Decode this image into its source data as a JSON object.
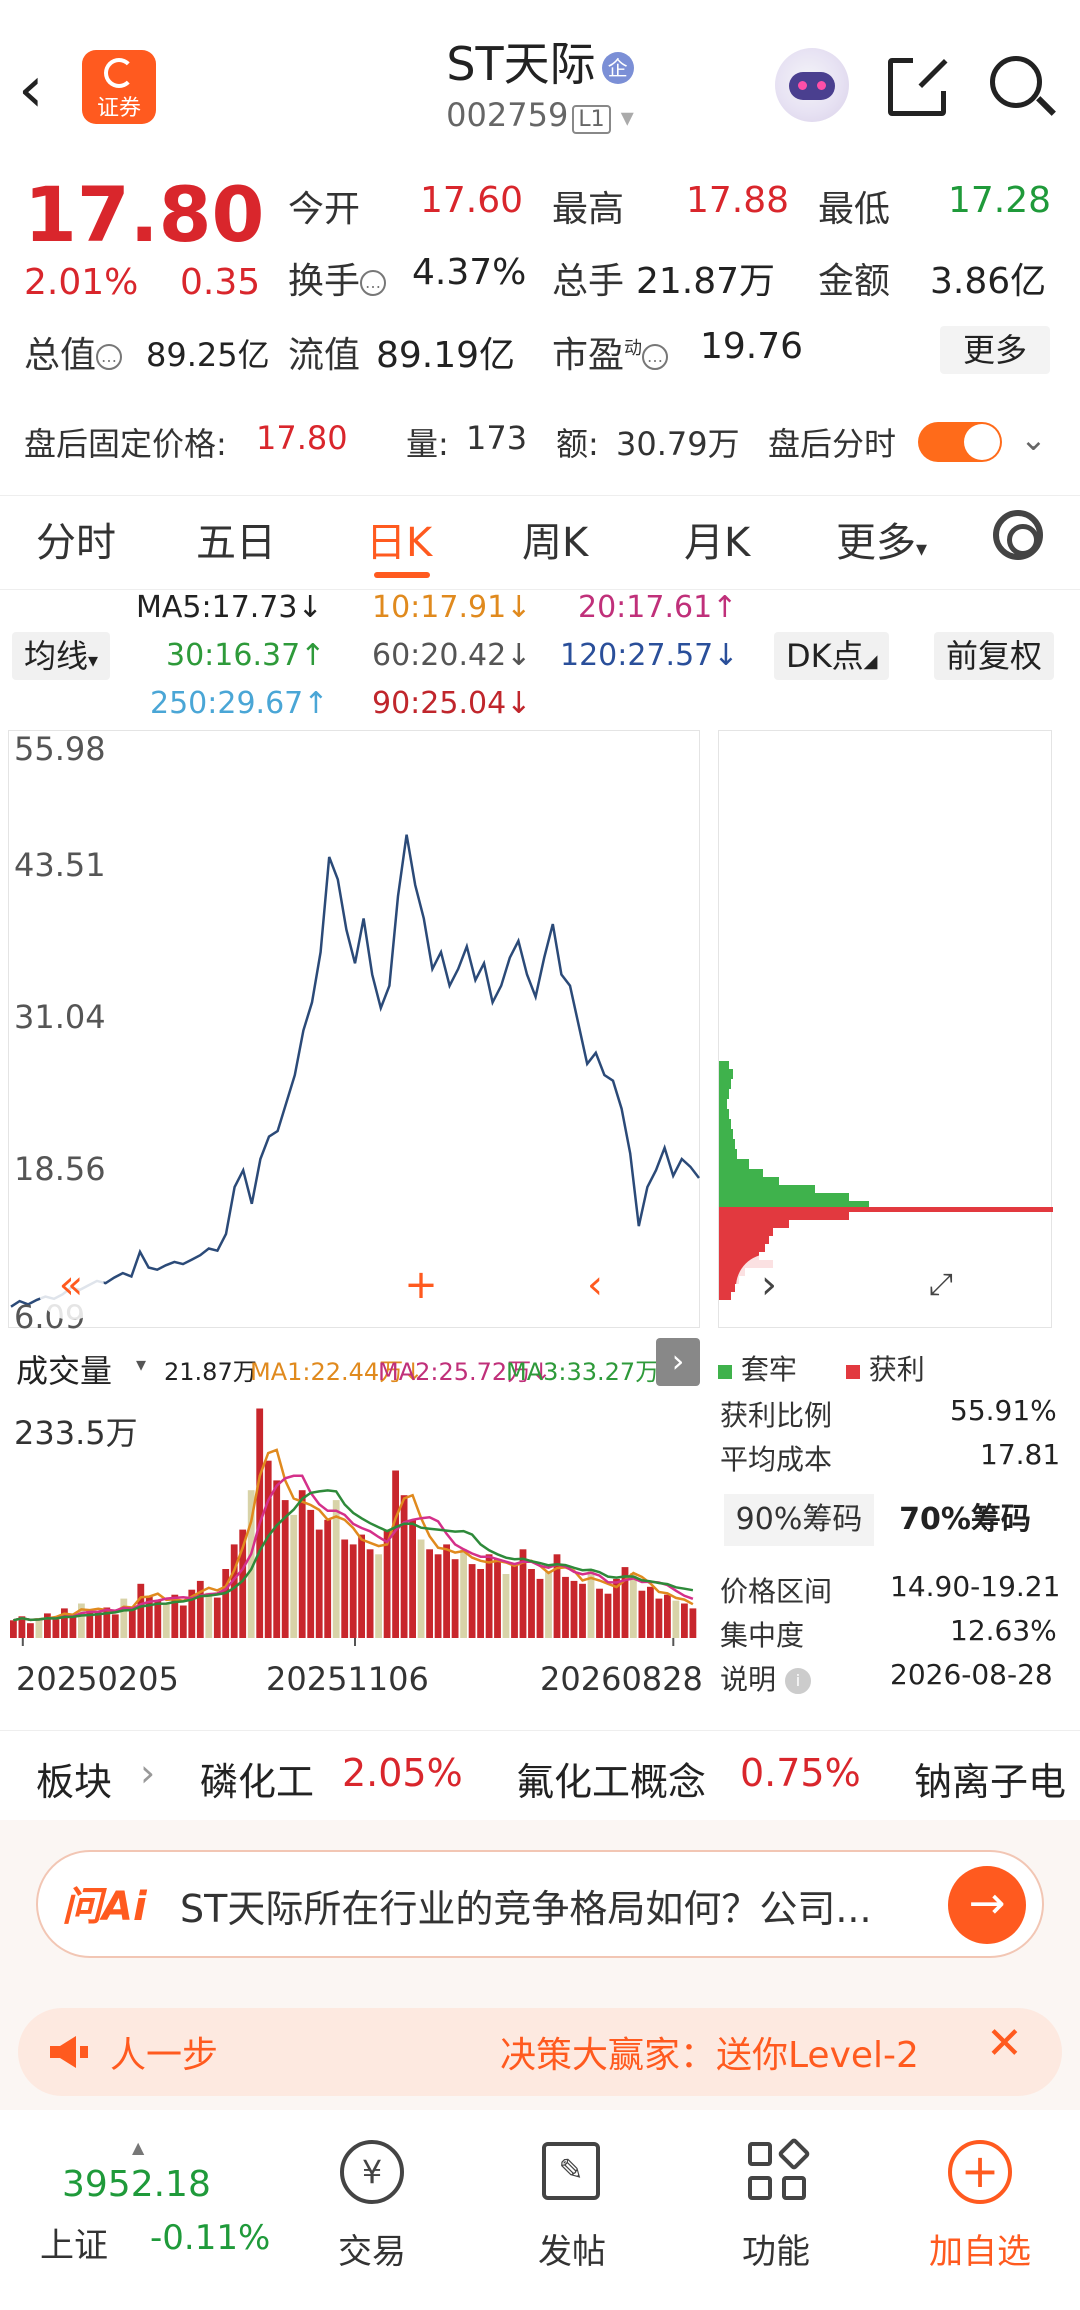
{
  "header": {
    "back_icon": "back-arrow-icon",
    "brand_label": "证券",
    "title": "ST天际",
    "badge": "企",
    "code": "002759",
    "level": "L1"
  },
  "quote": {
    "price": "17.80",
    "change_pct": "2.01%",
    "change_abs": "0.35",
    "fields": [
      {
        "label": "今开",
        "value": "17.60",
        "tone": "red"
      },
      {
        "label": "最高",
        "value": "17.88",
        "tone": "red"
      },
      {
        "label": "最低",
        "value": "17.28",
        "tone": "green"
      },
      {
        "label": "换手",
        "value": "4.37%",
        "tone": "plain"
      },
      {
        "label": "总手",
        "value": "21.87万",
        "tone": "plain"
      },
      {
        "label": "金额",
        "value": "3.86亿",
        "tone": "plain"
      },
      {
        "label": "总值",
        "value": "89.25亿",
        "tone": "plain"
      },
      {
        "label": "流值",
        "value": "89.19亿",
        "tone": "plain"
      },
      {
        "label": "市盈",
        "label_sup": "动",
        "value": "19.76",
        "tone": "plain"
      }
    ],
    "more_label": "更多"
  },
  "after_hours": {
    "fixed_price_label": "盘后固定价格:",
    "fixed_price": "17.80",
    "volume_label": "量:",
    "volume": "173",
    "amount_label": "额:",
    "amount": "30.79万",
    "timeshare_label": "盘后分时"
  },
  "tabs": [
    "分时",
    "五日",
    "日K",
    "周K",
    "月K",
    "更多"
  ],
  "active_tab": "日K",
  "indicators": {
    "ma_label": "均线",
    "dk_label": "DK点",
    "adjust_label": "前复权",
    "ma_lines": [
      {
        "text": "MA5:17.73↓",
        "color": "#333333"
      },
      {
        "text": "10:17.91↓",
        "color": "#e08a1e"
      },
      {
        "text": "20:17.61↑",
        "color": "#c0307a"
      },
      {
        "text": "30:16.37↑",
        "color": "#2e9a3a"
      },
      {
        "text": "60:20.42↓",
        "color": "#555555"
      },
      {
        "text": "120:27.57↓",
        "color": "#2a4f9a"
      },
      {
        "text": "250:29.67↑",
        "color": "#4aa6d6"
      },
      {
        "text": "90:25.04↓",
        "color": "#c0262c"
      }
    ]
  },
  "chart_data": {
    "type": "line",
    "title": "",
    "y_ticks": [
      "55.98",
      "43.51",
      "31.04",
      "18.56",
      "6.09"
    ],
    "ylim": [
      6.09,
      55.98
    ],
    "x_ticks": [
      "20250205",
      "20251106",
      "20260828"
    ],
    "series": [
      {
        "name": "",
        "values": [
          6.3,
          6.8,
          6.5,
          6.9,
          7.2,
          7.0,
          7.4,
          8.0,
          7.8,
          8.2,
          8.6,
          8.4,
          8.9,
          9.3,
          9.0,
          11.2,
          9.8,
          9.6,
          10.0,
          10.3,
          10.1,
          10.5,
          10.9,
          11.5,
          11.3,
          12.8,
          17.0,
          18.5,
          15.5,
          19.5,
          21.5,
          22.0,
          24.5,
          27.0,
          31.0,
          33.5,
          38.0,
          46.5,
          44.5,
          40.0,
          37.0,
          41.0,
          36.0,
          33.0,
          35.0,
          43.0,
          48.5,
          44.0,
          41.0,
          36.5,
          38.0,
          35.0,
          36.5,
          38.5,
          35.5,
          37.0,
          33.5,
          35.0,
          37.5,
          39.0,
          36.0,
          34.0,
          37.5,
          40.5,
          36.0,
          35.0,
          31.5,
          28.0,
          29.0,
          27.0,
          26.5,
          24.0,
          20.0,
          13.5,
          17.0,
          18.5,
          20.5,
          18.0,
          19.5,
          18.8,
          17.8
        ]
      }
    ],
    "volume": {
      "label": "成交量",
      "total": "21.87万",
      "ma1": "MA1:22.44万↓",
      "ma2": "MA2:25.72万↓",
      "ma3": "MA3:33.27万↓",
      "y_max_label": "233.5万",
      "values": [
        18,
        22,
        15,
        20,
        25,
        19,
        30,
        22,
        35,
        28,
        26,
        31,
        24,
        40,
        29,
        55,
        42,
        38,
        36,
        44,
        33,
        49,
        58,
        46,
        41,
        70,
        95,
        110,
        150,
        233,
        180,
        160,
        140,
        125,
        150,
        130,
        110,
        120,
        140,
        100,
        95,
        105,
        90,
        85,
        110,
        170,
        145,
        120,
        100,
        90,
        85,
        95,
        80,
        90,
        75,
        70,
        85,
        80,
        65,
        75,
        90,
        70,
        60,
        68,
        85,
        62,
        58,
        55,
        70,
        50,
        45,
        60,
        72,
        66,
        48,
        52,
        40,
        44,
        38,
        35,
        30
      ]
    }
  },
  "chip_panel": {
    "legend_trapped": "套牢",
    "legend_profit": "获利",
    "rows": [
      {
        "label": "获利比例",
        "value": "55.91%"
      },
      {
        "label": "平均成本",
        "value": "17.81"
      }
    ],
    "tab_90": "90%筹码",
    "tab_70": "70%筹码",
    "rows2": [
      {
        "label": "价格区间",
        "value": "14.90-19.21"
      },
      {
        "label": "集中度",
        "value": "12.63%"
      },
      {
        "label": "说明",
        "value": "2026-08-28"
      }
    ]
  },
  "sectors": {
    "label": "板块",
    "items": [
      {
        "name": "磷化工",
        "pct": "2.05%"
      },
      {
        "name": "氟化工概念",
        "pct": "0.75%"
      },
      {
        "name": "钠离子电",
        "pct": ""
      }
    ]
  },
  "ai": {
    "logo": "问Ai",
    "question": "ST天际所在行业的竞争格局如何？公司..."
  },
  "promo": {
    "left": "人一步",
    "right": "决策大赢家：送你Level-2"
  },
  "bottom_nav": {
    "index_value": "3952.18",
    "index_name": "上证",
    "index_change": "-0.11%",
    "items": [
      "交易",
      "发帖",
      "功能",
      "加自选"
    ]
  },
  "colors": {
    "accent": "#ff5a1f",
    "up": "#d9262c",
    "down": "#1f9a3a",
    "line": "#2b4a78"
  }
}
